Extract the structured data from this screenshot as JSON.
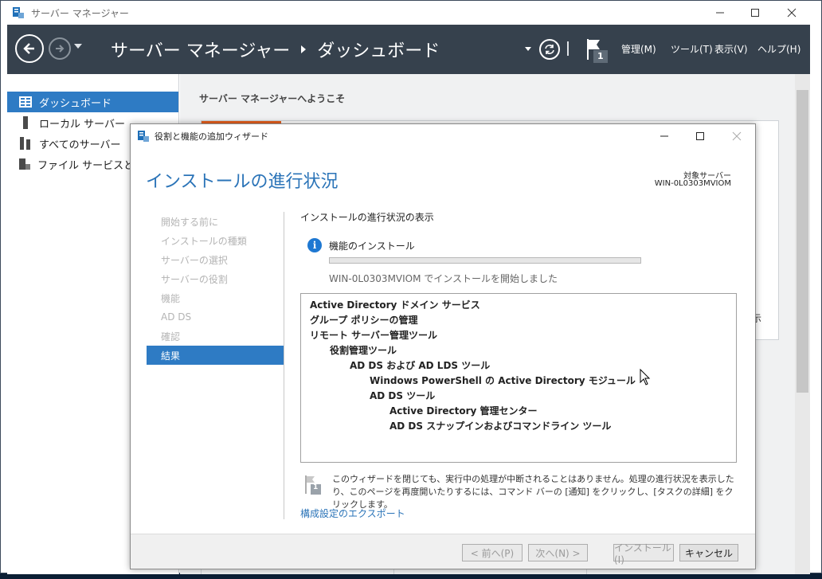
{
  "main_window": {
    "title": "サーバー マネージャー",
    "header": {
      "breadcrumb": [
        "サーバー マネージャー",
        "ダッシュボード"
      ],
      "notification_count": "1",
      "menus": [
        "管理(M)",
        "ツール(T)",
        "表示(V)",
        "ヘルプ(H)"
      ]
    },
    "sidebar": {
      "items": [
        {
          "label": "ダッシュボード",
          "icon": "dashboard-icon",
          "selected": true
        },
        {
          "label": "ローカル サーバー",
          "icon": "server-icon"
        },
        {
          "label": "すべてのサーバー",
          "icon": "servers-icon"
        },
        {
          "label": "ファイル サービスと記憶域サービス",
          "icon": "file-services-icon"
        }
      ]
    },
    "content": {
      "welcome": "サーバー マネージャーへようこそ",
      "peek_text": "示"
    }
  },
  "wizard": {
    "title": "役割と機能の追加ウィザード",
    "heading": "インストールの進行状況",
    "target_server_label": "対象サーバー",
    "target_server": "WIN-0L0303MVIOM",
    "steps": [
      "開始する前に",
      "インストールの種類",
      "サーバーの選択",
      "サーバーの役割",
      "機能",
      "AD DS",
      "確認",
      "結果"
    ],
    "active_step_index": 7,
    "progress_section_title": "インストールの進行状況の表示",
    "feature_installation": "機能のインストール",
    "progress_fraction": 0.0,
    "status": "WIN-0L0303MVIOM でインストールを開始しました",
    "features": [
      {
        "label": "Active Directory ドメイン サービス",
        "level": 0
      },
      {
        "label": "グループ ポリシーの管理",
        "level": 0
      },
      {
        "label": "リモート サーバー管理ツール",
        "level": 0
      },
      {
        "label": "役割管理ツール",
        "level": 1
      },
      {
        "label": "AD DS および AD LDS ツール",
        "level": 2
      },
      {
        "label": "Windows PowerShell の Active Directory モジュール",
        "level": 3
      },
      {
        "label": "AD DS ツール",
        "level": 3
      },
      {
        "label": "Active Directory 管理センター",
        "level": 4
      },
      {
        "label": "AD DS スナップインおよびコマンドライン ツール",
        "level": 4
      }
    ],
    "notice": "このウィザードを閉じても、実行中の処理が中断されることはありません。処理の進行状況を表示したり、このページを再度開いたりするには、コマンド バーの [通知] をクリックし、[タスクの詳細] をクリックします。",
    "notice_badge": "1",
    "export_link": "構成設定のエクスポート",
    "buttons": {
      "prev": "< 前へ(P)",
      "next": "次へ(N) >",
      "install": "インストール(I)",
      "cancel": "キャンセル"
    }
  },
  "colors": {
    "header_bg": "#36414d",
    "accent_blue": "#2e7bc4",
    "heading_blue": "#2b74b8",
    "welcome_accent": "#e9611e"
  }
}
